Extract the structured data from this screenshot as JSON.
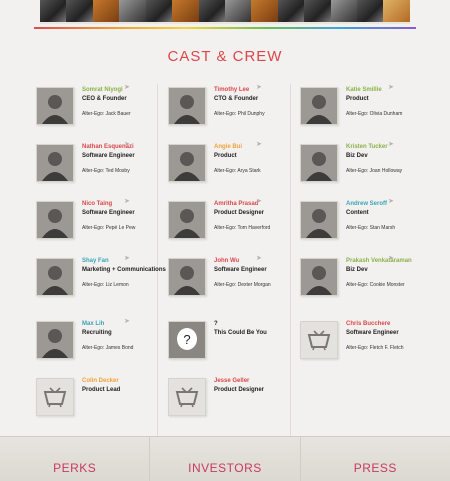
{
  "section_title": "CAST & CREW",
  "colors": {
    "accent": "#d9474a",
    "footer_text": "#c73b5c"
  },
  "members": [
    {
      "name": "Somrat Niyogi",
      "name_color": "#8ab14a",
      "role": "CEO & Founder",
      "alter": "Alter-Ego: Jack Bauer",
      "avatar": "photo"
    },
    {
      "name": "Timothy Lee",
      "name_color": "#d9474a",
      "role": "CTO & Founder",
      "alter": "Alter-Ego: Phil Dunphy",
      "avatar": "photo"
    },
    {
      "name": "Katie Smillie",
      "name_color": "#8ab14a",
      "role": "Product",
      "alter": "Alter-Ego: Olivia Dunham",
      "avatar": "photo"
    },
    {
      "name": "Nathan Esquenazi",
      "name_color": "#d9474a",
      "role": "Software Engineer",
      "alter": "Alter-Ego: Ted Mosby",
      "avatar": "photo"
    },
    {
      "name": "Angie Bui",
      "name_color": "#f2a03a",
      "role": "Product",
      "alter": "Alter-Ego: Arya Stark",
      "avatar": "photo"
    },
    {
      "name": "Kristen Tucker",
      "name_color": "#8ab14a",
      "role": "Biz Dev",
      "alter": "Alter-Ego: Joan Holloway",
      "avatar": "photo"
    },
    {
      "name": "Nico Taing",
      "name_color": "#d9474a",
      "role": "Software Engineer",
      "alter": "Alter-Ego: Pepé Le Pew",
      "avatar": "photo"
    },
    {
      "name": "Amritha Prasad",
      "name_color": "#d9474a",
      "role": "Product Designer",
      "alter": "Alter-Ego: Tom Haverford",
      "avatar": "photo"
    },
    {
      "name": "Andrew Seroff",
      "name_color": "#3aa5b5",
      "role": "Content",
      "alter": "Alter-Ego: Stan Marsh",
      "avatar": "photo"
    },
    {
      "name": "Shay Fan",
      "name_color": "#3aa5b5",
      "role": "Marketing + Communications",
      "alter": "Alter-Ego: Liz Lemon",
      "avatar": "photo"
    },
    {
      "name": "John Wu",
      "name_color": "#d9474a",
      "role": "Software Engineer",
      "alter": "Alter-Ego: Dexter Morgan",
      "avatar": "photo"
    },
    {
      "name": "Prakash Venkataraman",
      "name_color": "#8ab14a",
      "role": "Biz Dev",
      "alter": "Alter-Ego: Cookie Monster",
      "avatar": "photo"
    },
    {
      "name": "Max Lih",
      "name_color": "#3aa5b5",
      "role": "Recruiting",
      "alter": "Alter-Ego: James Bond",
      "avatar": "photo"
    },
    {
      "name": "?",
      "name_color": "#222222",
      "role": "This Could Be You",
      "alter": "",
      "avatar": "question"
    },
    {
      "name": "Chris Bucchere",
      "name_color": "#d9474a",
      "role": "Software Engineer",
      "alter": "Alter-Ego: Fletch F. Fletch",
      "avatar": "tv"
    },
    {
      "name": "Colin Decker",
      "name_color": "#f2a03a",
      "role": "Product Lead",
      "alter": "",
      "avatar": "tv"
    },
    {
      "name": "Jesse Geller",
      "name_color": "#d9474a",
      "role": "Product Designer",
      "alter": "",
      "avatar": "tv"
    }
  ],
  "footer": {
    "tabs": [
      "PERKS",
      "INVESTORS",
      "PRESS"
    ]
  }
}
